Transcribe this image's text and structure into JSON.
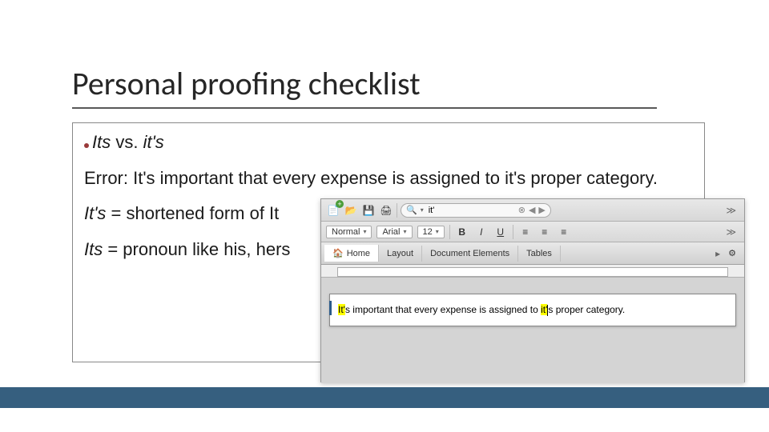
{
  "title": "Personal proofing checklist",
  "bullet": {
    "its": "Its",
    "vs": " vs. ",
    "its2": "it's"
  },
  "error_line": "Error: It's important that every expense is assigned to it's proper category.",
  "def1_it": "It's",
  "def1_rest": " = shortened form of It",
  "def2_it": "Its",
  "def2_rest": " = pronoun like his, hers",
  "word": {
    "search_value": "it'",
    "style": "Normal",
    "font": "Arial",
    "size": "12",
    "tabs": {
      "home": "Home",
      "layout": "Layout",
      "docel": "Document Elements",
      "tables": "Tables"
    },
    "doc_prefix": "It'",
    "doc_mid1": "s important that every expense is assigned to ",
    "doc_hl2": "it'",
    "doc_mid2": "s proper category."
  }
}
